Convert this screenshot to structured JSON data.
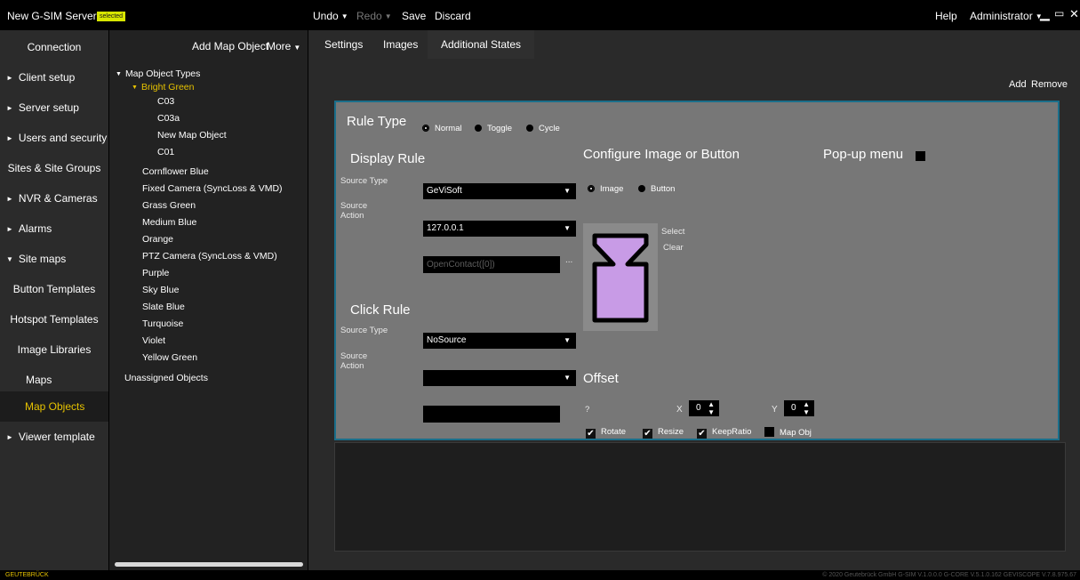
{
  "topbar": {
    "title": "New G-SIM Server",
    "badge": "selected",
    "undo": "Undo",
    "redo": "Redo",
    "save": "Save",
    "discard": "Discard",
    "help": "Help",
    "user": "Administrator"
  },
  "nav": {
    "items": [
      {
        "label": "Connection"
      },
      {
        "label": "Client setup"
      },
      {
        "label": "Server setup"
      },
      {
        "label": "Users and security"
      },
      {
        "label": "Sites & Site Groups"
      },
      {
        "label": "NVR & Cameras"
      },
      {
        "label": "Alarms"
      },
      {
        "label": "Site maps"
      },
      {
        "label": "Button Templates"
      },
      {
        "label": "Hotspot Templates"
      },
      {
        "label": "Image Libraries"
      },
      {
        "label": "Maps"
      },
      {
        "label": "Map Objects"
      },
      {
        "label": "Viewer template"
      }
    ]
  },
  "tree": {
    "add_label": "Add Map Object",
    "more_label": "More",
    "root": "Map Object Types",
    "selected_group": "Bright Green",
    "children": [
      "C03",
      "C03a",
      "New Map Object",
      "C01"
    ],
    "groups": [
      "Cornflower Blue",
      "Fixed Camera (SyncLoss & VMD)",
      "Grass Green",
      "Medium Blue",
      "Orange",
      "PTZ Camera (SyncLoss & VMD)",
      "Purple",
      "Sky Blue",
      "Slate Blue",
      "Turquoise",
      "Violet",
      "Yellow Green"
    ],
    "unassigned": "Unassigned Objects"
  },
  "tabs": [
    "Settings",
    "Images",
    "Additional States"
  ],
  "actions": {
    "add": "Add",
    "remove": "Remove"
  },
  "editor": {
    "rule_type": "Rule Type",
    "rule_options": [
      "Normal",
      "Toggle",
      "Cycle"
    ],
    "display_rule": "Display Rule",
    "source_type_label": "Source Type",
    "source_type_value": "GeViSoft",
    "source_action_label": "Source Action",
    "source_action_value": "127.0.0.1",
    "action_text": "OpenContact([0])",
    "ellipsis": "...",
    "click_rule": "Click Rule",
    "click_source_type_label": "Source Type",
    "click_source_type_value": "NoSource",
    "click_source_action_label": "Source Action",
    "configure_title": "Configure Image or Button",
    "config_options": [
      "Image",
      "Button"
    ],
    "select": "Select",
    "clear": "Clear",
    "popup_label": "Pop-up menu",
    "offset": "Offset",
    "question": "?",
    "x_label": "X",
    "x_value": "0",
    "y_label": "Y",
    "y_value": "0",
    "checks": [
      {
        "label": "Rotate",
        "checked": true
      },
      {
        "label": "Resize",
        "checked": true
      },
      {
        "label": "KeepRatio",
        "checked": true
      },
      {
        "label": "Map Obj",
        "checked": false
      }
    ],
    "icon_fill": "#c89be6"
  },
  "status": {
    "brand": "GEUTEBRÜCK",
    "copyright": "© 2020 Geutebrück GmbH   G-SIM V.1.0.0.0   G-CORE V.5.1.0.162   GEVISCOPE V.7.8.975.67"
  }
}
